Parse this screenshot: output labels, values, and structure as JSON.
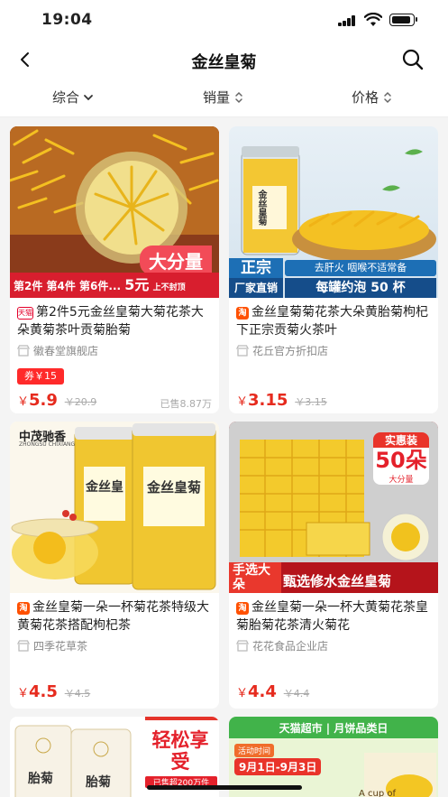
{
  "status": {
    "time": "19:04"
  },
  "nav": {
    "title": "金丝皇菊"
  },
  "sort": [
    {
      "label": "综合"
    },
    {
      "label": "销量"
    },
    {
      "label": "价格"
    }
  ],
  "colors": {
    "price": "#e62b1e",
    "accent": "#ff2a2a",
    "platform_badge": "#ff5000"
  },
  "products": [
    {
      "badge": "天猫",
      "title": "第2件5元金丝皇菊大菊花茶大朵黄菊茶叶贡菊胎菊",
      "shop": "徽春堂旗舰店",
      "coupon": "券￥15",
      "price": "5.9",
      "orig_price": "20.9",
      "sold": "已售8.87万",
      "img": {
        "tag": "大分量",
        "banner": "第2件 第4件 第6件...",
        "banner_price": "5元",
        "banner_note": "上不封顶"
      }
    },
    {
      "badge": "淘",
      "title": "金丝皇菊菊花茶大朵黄胎菊枸杞下正宗贡菊火茶叶",
      "shop": "花丘官方折扣店",
      "price": "3.15",
      "orig_price": "3.15",
      "img": {
        "tag": "正宗",
        "tag2": "厂家直销",
        "line1": "去肝火 咽喉不适常备",
        "line2": "每罐约泡 50 杯",
        "jar": "金丝皇菊"
      }
    },
    {
      "badge": "淘",
      "title": "金丝皇菊一朵一杯菊花茶特级大黄菊花茶搭配枸杞茶",
      "shop": "四季花草茶",
      "price": "4.5",
      "orig_price": "4.5",
      "img": {
        "brand": "中茂驰香",
        "brand_en": "ZHONGSU CHIXIANG",
        "jar1": "金丝皇",
        "jar2": "金丝皇菊"
      }
    },
    {
      "badge": "淘",
      "title": "金丝皇菊一朵一杯大黄菊花茶皇菊胎菊花茶清火菊花",
      "shop": "花花食品企业店",
      "price": "4.4",
      "orig_price": "4.4",
      "img": {
        "tag1": "实惠装",
        "tag2": "50朵",
        "tag3": "大分量",
        "bottom_left": "手选大朵",
        "bottom_right": "甄选修水金丝皇菊"
      }
    },
    {
      "img": {
        "label1": "胎菊",
        "label2": "胎菊",
        "headline": "轻松享受",
        "sub": "已售超200万件"
      }
    },
    {
      "img": {
        "banner": "天猫超市 | 月饼品类日",
        "sub": "活动时间",
        "date": "9月1日-9月3日",
        "cup": "A cup of"
      }
    }
  ]
}
